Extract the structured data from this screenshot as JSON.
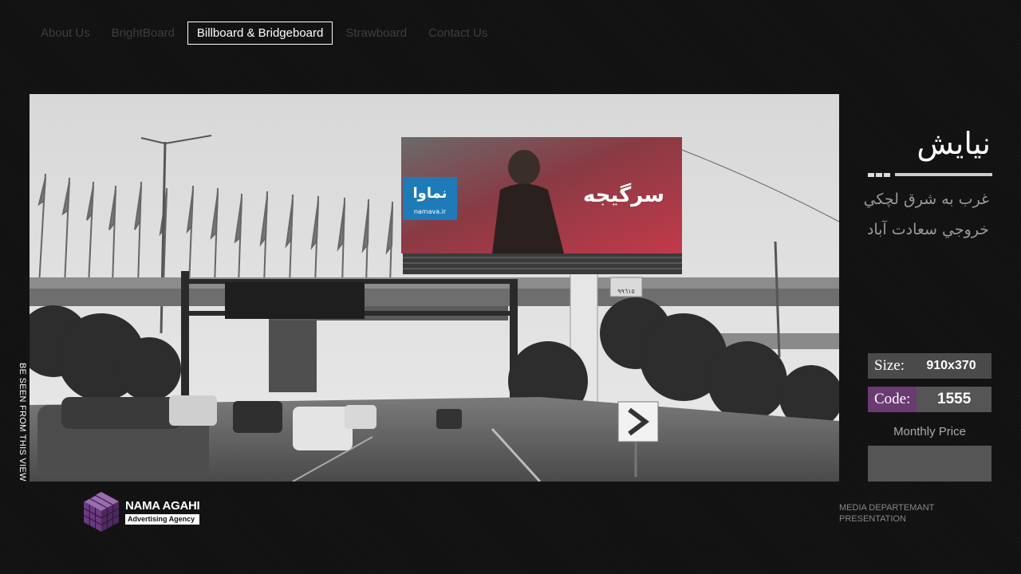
{
  "nav": {
    "items": [
      {
        "label": "About Us",
        "active": false
      },
      {
        "label": "BrightBoard",
        "active": false
      },
      {
        "label": "Billboard & Bridgeboard",
        "active": true
      },
      {
        "label": "Strawboard",
        "active": false
      },
      {
        "label": "Contact Us",
        "active": false
      }
    ]
  },
  "photo": {
    "caption": "BE SEEN FROM THIS VIEW",
    "billboard_brand": "نماوا",
    "billboard_url": "namava.ir",
    "billboard_title": "سرگیجه",
    "bottom_number": "٩٩٦١٥"
  },
  "location": {
    "title": "نيايش",
    "line1": "غرب به شرق لچکي",
    "line2": "خروجي سعادت آباد"
  },
  "specs": {
    "size_label": "Size:",
    "size_value": "910x370",
    "code_label": "Code:",
    "code_value": "1555",
    "price_label": "Monthly Price",
    "price_value": ""
  },
  "footer": {
    "logo_name": "NAMA AGAHI",
    "logo_tagline": "Advertising Agency",
    "note_line1": "MEDIA DEPARTEMANT",
    "note_line2": "PRESENTATION"
  },
  "colors": {
    "accent_purple": "#6b3a73",
    "box_gray": "#555555",
    "billboard_red": "#b0323e",
    "brand_blue": "#1e7bb8"
  }
}
